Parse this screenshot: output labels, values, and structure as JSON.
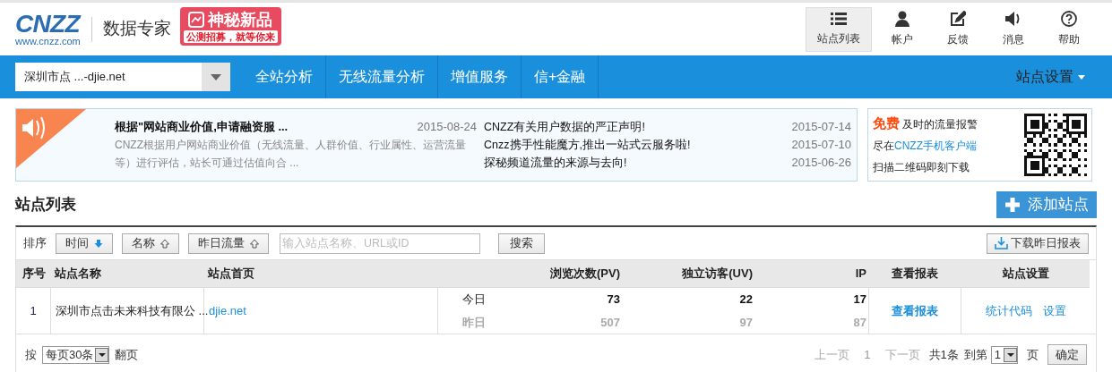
{
  "logo": {
    "brand": "CNZZ",
    "url": "www.cnzz.com"
  },
  "product": "数据专家",
  "promo": {
    "title": "神秘新品",
    "subtitle": "公测招募，就等你来"
  },
  "top_tools": [
    {
      "label": "站点列表",
      "selected": true
    },
    {
      "label": "帐户",
      "selected": false
    },
    {
      "label": "反馈",
      "selected": false
    },
    {
      "label": "消息",
      "selected": false
    },
    {
      "label": "帮助",
      "selected": false
    }
  ],
  "nav": {
    "site_select": "深圳市点 ...-djie.net",
    "tabs": [
      "全站分析",
      "无线流量分析",
      "增值服务",
      "信+金融"
    ],
    "settings_menu": "站点设置"
  },
  "notices": {
    "featured": {
      "title": "根据\"网站商业价值,申请融资服 ...",
      "date": "2015-08-24",
      "summary": "CNZZ根据用户网站商业价值（无线流量、人群价值、行业属性、运营流量等）进行评估，站长可通过估值向合 ..."
    },
    "items": [
      {
        "title": "CNZZ有关用户数据的严正声明!",
        "date": "2015-07-14"
      },
      {
        "title": "Cnzz携手性能魔方,推出一站式云服务啦!",
        "date": "2015-07-10"
      },
      {
        "title": "探秘频道流量的来源与去向!",
        "date": "2015-06-26"
      }
    ]
  },
  "app_card": {
    "highlight": "免费",
    "line_1": "及时的流量报警",
    "line_2": "尽在",
    "link": "CNZZ手机客户端",
    "line_3": "扫描二维码即刻下载"
  },
  "section_title": "站点列表",
  "add_button": "添加站点",
  "toolbar": {
    "sort_label": "排序",
    "sort_buttons": [
      {
        "label": "时间",
        "selected": true
      },
      {
        "label": "名称",
        "selected": false
      },
      {
        "label": "昨日流量",
        "selected": false
      }
    ],
    "search_placeholder": "输入站点名称、URL或ID",
    "search_button": "搜索",
    "download_button": "下载昨日报表"
  },
  "table": {
    "columns": [
      "序号",
      "站点名称",
      "站点首页",
      "浏览次数(PV)",
      "独立访客(UV)",
      "IP",
      "查看报表",
      "站点设置"
    ],
    "rows": [
      {
        "index": "1",
        "name": "深圳市点击未来科技有限公 ...",
        "homepage": "djie.net",
        "periods": [
          {
            "label": "今日",
            "pv": "73",
            "uv": "22",
            "ip": "17",
            "muted": false
          },
          {
            "label": "昨日",
            "pv": "507",
            "uv": "97",
            "ip": "87",
            "muted": true
          }
        ],
        "report_link": "查看报表",
        "actions": [
          "统计代码",
          "设置"
        ]
      }
    ]
  },
  "pager": {
    "prefix": "按",
    "page_size": "每页30条",
    "suffix": "翻页",
    "prev": "上一页",
    "current": "1",
    "next": "下一页",
    "total": "共1条",
    "goto": "到第",
    "page": "1",
    "page_unit": "页",
    "confirm": "确定"
  }
}
